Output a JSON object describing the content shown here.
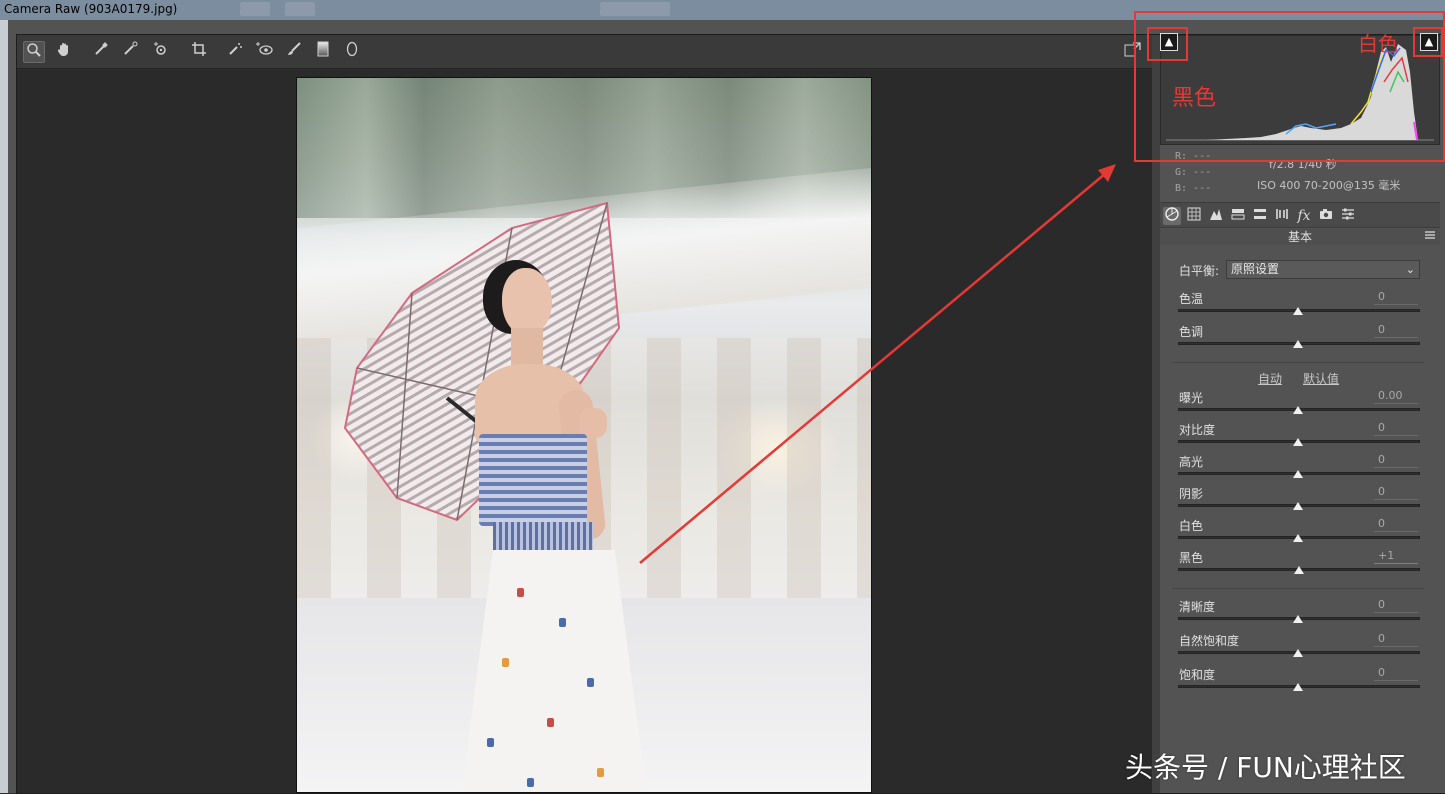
{
  "window": {
    "title": "Camera Raw (903A0179.jpg)"
  },
  "toolbar": {
    "tools": [
      {
        "name": "zoom-tool",
        "glyph": "🔍"
      },
      {
        "name": "hand-tool",
        "glyph": "✋"
      },
      {
        "name": "white-balance-tool",
        "glyph": "✎"
      },
      {
        "name": "color-sampler-tool",
        "glyph": "✎"
      },
      {
        "name": "targeted-adjustment-tool",
        "glyph": "⊙"
      },
      {
        "name": "crop-tool",
        "glyph": "⌗"
      },
      {
        "name": "spot-removal-tool",
        "glyph": "✎"
      },
      {
        "name": "red-eye-tool",
        "glyph": "◉"
      },
      {
        "name": "adjustment-brush-tool",
        "glyph": "✎"
      },
      {
        "name": "graduated-filter-tool",
        "glyph": "▮"
      },
      {
        "name": "radial-filter-tool",
        "glyph": "○"
      }
    ]
  },
  "histogram": {
    "info": {
      "r": "R: ---",
      "g": "G: ---",
      "b": "B: ---",
      "aperture_shutter": "f/2.8   1/40 秒",
      "iso_lens": "ISO 400   70-200@135 毫米"
    }
  },
  "panel": {
    "section_title": "基本",
    "white_balance_label": "白平衡:",
    "white_balance_value": "原照设置",
    "auto_link": "自动",
    "default_link": "默认值",
    "sliders": [
      {
        "key": "temp",
        "label": "色温",
        "value": "0"
      },
      {
        "key": "tint",
        "label": "色调",
        "value": "0"
      },
      {
        "key": "exposure",
        "label": "曝光",
        "value": "0.00"
      },
      {
        "key": "contrast",
        "label": "对比度",
        "value": "0"
      },
      {
        "key": "highlights",
        "label": "高光",
        "value": "0"
      },
      {
        "key": "shadows",
        "label": "阴影",
        "value": "0"
      },
      {
        "key": "whites",
        "label": "白色",
        "value": "0"
      },
      {
        "key": "blacks",
        "label": "黑色",
        "value": "+1"
      },
      {
        "key": "clarity",
        "label": "清晰度",
        "value": "0"
      },
      {
        "key": "vibrance",
        "label": "自然饱和度",
        "value": "0"
      },
      {
        "key": "saturation",
        "label": "饱和度",
        "value": "0"
      }
    ]
  },
  "annotations": {
    "black_label": "黑色",
    "white_label": "白色",
    "color": "#e53935"
  },
  "watermark": "头条号 / FUN心理社区"
}
